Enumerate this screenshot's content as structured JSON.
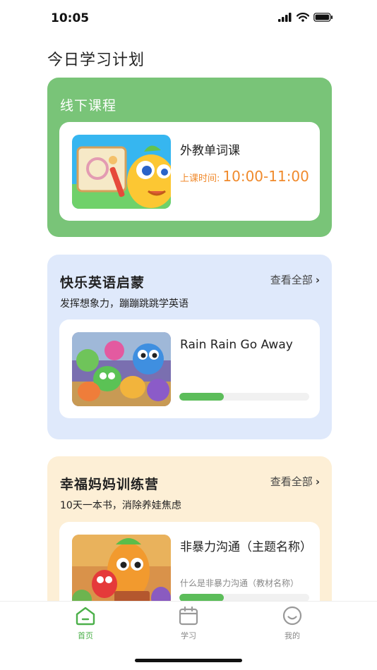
{
  "status_bar": {
    "time": "10:05"
  },
  "page": {
    "title": "今日学习计划"
  },
  "offline_section": {
    "title": "线下课程",
    "lesson": {
      "title": "外教单词课",
      "time_label": "上课时间:",
      "time_value": "10:00-11:00"
    }
  },
  "english_section": {
    "title": "快乐英语启蒙",
    "view_all": "查看全部",
    "subtitle": "发挥想象力，蹦蹦跳跳学英语",
    "course": {
      "title": "Rain Rain Go Away",
      "progress": 0.34
    }
  },
  "parent_section": {
    "title": "幸福妈妈训练营",
    "view_all": "查看全部",
    "subtitle": "10天一本书，消除养娃焦虑",
    "course": {
      "title": "非暴力沟通（主题名称）",
      "subtitle": "什么是非暴力沟通（教材名称）",
      "progress": 0.34
    }
  },
  "tab_bar": {
    "tabs": [
      {
        "label": "首页",
        "icon": "home-icon",
        "active": true
      },
      {
        "label": "学习",
        "icon": "calendar-icon",
        "active": false
      },
      {
        "label": "我的",
        "icon": "smiley-icon",
        "active": false
      }
    ],
    "active_color": "#4cb04a",
    "inactive_color": "#888888"
  },
  "colors": {
    "offline_card": "#79c478",
    "english_card": "#dfe9fb",
    "parent_card": "#fdefd6",
    "time_accent": "#f08a2c",
    "progress": "#5cbd5a"
  }
}
